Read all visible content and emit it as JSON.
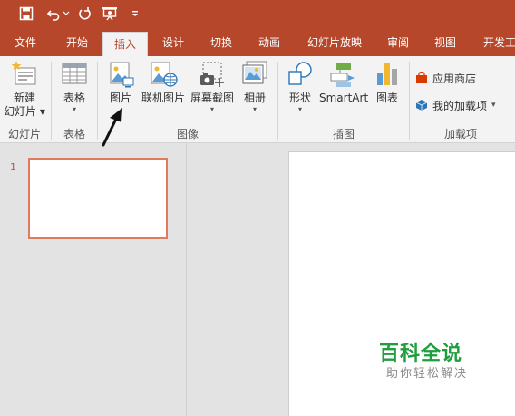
{
  "tabs": [
    "文件",
    "开始",
    "插入",
    "设计",
    "切换",
    "动画",
    "幻灯片放映",
    "审阅",
    "视图",
    "开发工"
  ],
  "active_tab": "插入",
  "ribbon": {
    "new_slide_line1": "新建",
    "new_slide_line2": "幻灯片",
    "table": "表格",
    "picture": "图片",
    "online_picture": "联机图片",
    "screenshot": "屏幕截图",
    "album": "相册",
    "shapes": "形状",
    "smartart": "SmartArt",
    "chart": "图表",
    "app_store": "应用商店",
    "my_addins": "我的加载项"
  },
  "groups": {
    "slides": "幻灯片",
    "tables": "表格",
    "images": "图像",
    "illustrations": "插图",
    "addins": "加载项"
  },
  "slide_panel": {
    "slide_number": "1"
  },
  "watermark": {
    "main": "百科全说",
    "sub": "助你轻松解决"
  },
  "colors": {
    "brand": "#b7472a",
    "ribbon_bg": "#f3f3f3",
    "workspace_bg": "#e3e3e3",
    "thumb_border": "#e07b60",
    "watermark_green": "#1e9e3c"
  },
  "icons": [
    "save-icon",
    "undo-icon",
    "redo-icon",
    "present-icon",
    "customize-icon"
  ]
}
